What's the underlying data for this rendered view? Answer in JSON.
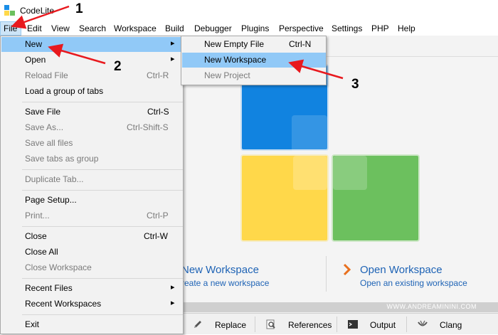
{
  "app": {
    "title": "CodeLite"
  },
  "menubar": {
    "items": [
      "File",
      "Edit",
      "View",
      "Search",
      "Workspace",
      "Build",
      "Debugger",
      "Plugins",
      "Perspective",
      "Settings",
      "PHP",
      "Help"
    ]
  },
  "file_menu": {
    "items": [
      {
        "label": "New",
        "shortcut": "",
        "submenu": true,
        "disabled": false,
        "selected": true
      },
      {
        "label": "Open",
        "shortcut": "",
        "submenu": true,
        "disabled": false
      },
      {
        "label": "Reload File",
        "shortcut": "Ctrl-R",
        "disabled": true
      },
      {
        "label": "Load a group of tabs",
        "shortcut": "",
        "disabled": false
      },
      {
        "label": "Save File",
        "shortcut": "Ctrl-S",
        "disabled": false
      },
      {
        "label": "Save As...",
        "shortcut": "Ctrl-Shift-S",
        "disabled": true
      },
      {
        "label": "Save all files",
        "shortcut": "",
        "disabled": true
      },
      {
        "label": "Save tabs as group",
        "shortcut": "",
        "disabled": true
      },
      {
        "label": "Duplicate Tab...",
        "shortcut": "",
        "disabled": true
      },
      {
        "label": "Page Setup...",
        "shortcut": "",
        "disabled": false
      },
      {
        "label": "Print...",
        "shortcut": "Ctrl-P",
        "disabled": true
      },
      {
        "label": "Close",
        "shortcut": "Ctrl-W",
        "disabled": false
      },
      {
        "label": "Close All",
        "shortcut": "",
        "disabled": false
      },
      {
        "label": "Close Workspace",
        "shortcut": "",
        "disabled": true
      },
      {
        "label": "Recent Files",
        "shortcut": "",
        "submenu": true,
        "disabled": false
      },
      {
        "label": "Recent Workspaces",
        "shortcut": "",
        "submenu": true,
        "disabled": false
      },
      {
        "label": "Exit",
        "shortcut": "",
        "disabled": false
      }
    ]
  },
  "new_submenu": {
    "items": [
      {
        "label": "New Empty File",
        "shortcut": "Ctrl-N",
        "disabled": false
      },
      {
        "label": "New Workspace",
        "shortcut": "",
        "disabled": false,
        "selected": true
      },
      {
        "label": "New Project",
        "shortcut": "",
        "disabled": true
      }
    ]
  },
  "welcome": {
    "new_workspace_title": "New Workspace",
    "new_workspace_sub": "reate a new workspace",
    "open_workspace_title": "Open Workspace",
    "open_workspace_sub": "Open an existing workspace",
    "watermark": "WWW.ANDREAMININI.COM"
  },
  "bottom_tabs": [
    {
      "label": "Replace",
      "icon": "pencil-icon"
    },
    {
      "label": "References",
      "icon": "magnifier-page-icon"
    },
    {
      "label": "Output",
      "icon": "terminal-icon"
    },
    {
      "label": "Clang",
      "icon": "clang-icon"
    }
  ],
  "annotations": [
    "1",
    "2",
    "3"
  ],
  "colors": {
    "menu_highlight": "#91c9f7",
    "link_blue": "#1e63b5",
    "annotation_arrow": "#e8191e"
  }
}
